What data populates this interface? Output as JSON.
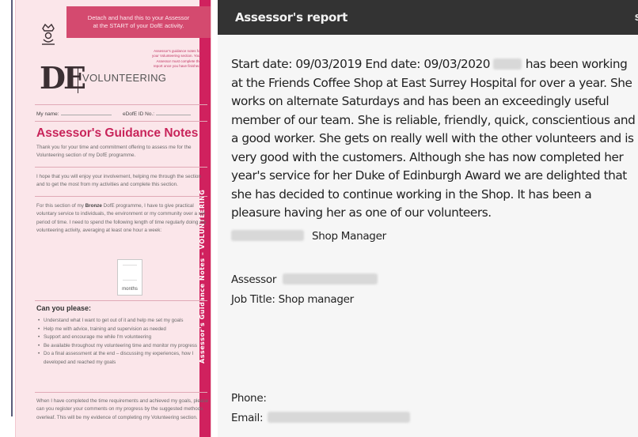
{
  "guidance_card": {
    "detach_notice": [
      "Detach and hand this to your Assessor",
      "at the START of your DofE activity."
    ],
    "logo_letters": "DE",
    "section_title": "VOLUNTEERING",
    "side_blurb": "Assessor's guidance notes for your Volunteering section. Your Assessor must complete the report once you have finished.",
    "my_name_label": "My name:",
    "edofe_label": "eDofE ID No.:",
    "title": "Assessor's Guidance Notes",
    "intro": "Thank you for your time and commitment offering to assess me for the Volunteering section of my DofE programme.",
    "hope_text": "I hope that you will enjoy your involvement, helping me through the section and to get the most from my activities and complete this section.",
    "requirement_text_before": "For this section of my ",
    "requirement_level": "Bronze",
    "requirement_text_after": " DofE programme, I have to give practical voluntary service to individuals, the environment or my community over a set period of time. I need to spend the following length of time regularly doing my volunteering activity, averaging at least one hour a week:",
    "months_label": "months",
    "can_you_title": "Can you please:",
    "can_you_items": [
      "Understand what I want to get out of it and help me set my goals",
      "Help me with advice, training and supervision as needed",
      "Support and encourage me while I'm volunteering",
      "Be available throughout my volunteering time and monitor my progress",
      "Do a final assessment at the end – discussing my experiences, how I developed and reached my goals"
    ],
    "closing_text": "When I have completed the time requirements and achieved my goals, please can you register your comments on my progress by the suggested methods overleaf. This will be my evidence of completing my Volunteering section.",
    "side_label": "Assessor's Guidance Notes – VOLUNTEERING"
  },
  "report": {
    "header_title": "Assessor's report",
    "header_right_char": "s",
    "start_label": "Start date: ",
    "start_date": "09/03/2019",
    "end_label": " End date: ",
    "end_date": "09/03/2020",
    "body": "has been working at the Friends Coffee Shop at East Surrey Hospital for over a year. She works on alternate Saturdays and has been an exceedingly useful member of our team. She is reliable, friendly, quick, conscientious and a good worker. She gets on really well with the other volunteers and is very good with the customers. Although she has now completed her year's service for her Duke of Edinburgh Award we are delighted that she has decided to continue working in the Shop. It has been a pleasure having her as one of our volunteers.",
    "signature_role": "Shop Manager",
    "assessor_label": "Assessor",
    "job_title_label": "Job Title: ",
    "job_title_value": "Shop manager",
    "phone_label": "Phone:",
    "email_label": "Email:"
  }
}
